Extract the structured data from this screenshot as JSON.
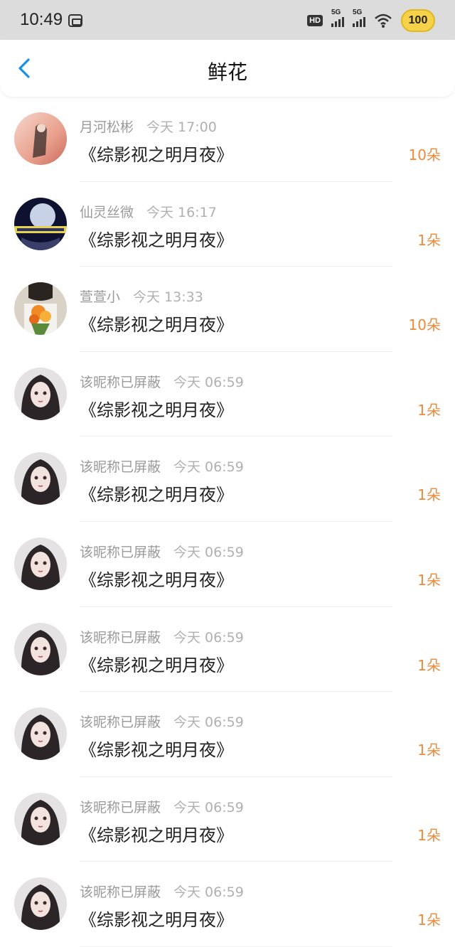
{
  "status": {
    "time": "10:49",
    "hd_label": "HD",
    "network_1": "5G",
    "network_2": "5G",
    "battery": "100"
  },
  "header": {
    "title": "鲜花"
  },
  "rows": [
    {
      "name": "月河松彬",
      "time": "今天 17:00",
      "title": "《综影视之明月夜》",
      "count": "10朵"
    },
    {
      "name": "仙灵丝微",
      "time": "今天 16:17",
      "title": "《综影视之明月夜》",
      "count": "1朵"
    },
    {
      "name": "萱萱小",
      "time": "今天 13:33",
      "title": "《综影视之明月夜》",
      "count": "10朵"
    },
    {
      "name": "该昵称已屏蔽",
      "time": "今天 06:59",
      "title": "《综影视之明月夜》",
      "count": "1朵"
    },
    {
      "name": "该昵称已屏蔽",
      "time": "今天 06:59",
      "title": "《综影视之明月夜》",
      "count": "1朵"
    },
    {
      "name": "该昵称已屏蔽",
      "time": "今天 06:59",
      "title": "《综影视之明月夜》",
      "count": "1朵"
    },
    {
      "name": "该昵称已屏蔽",
      "time": "今天 06:59",
      "title": "《综影视之明月夜》",
      "count": "1朵"
    },
    {
      "name": "该昵称已屏蔽",
      "time": "今天 06:59",
      "title": "《综影视之明月夜》",
      "count": "1朵"
    },
    {
      "name": "该昵称已屏蔽",
      "time": "今天 06:59",
      "title": "《综影视之明月夜》",
      "count": "1朵"
    },
    {
      "name": "该昵称已屏蔽",
      "time": "今天 06:59",
      "title": "《综影视之明月夜》",
      "count": "1朵"
    }
  ],
  "colors": {
    "accent": "#1a8ff0",
    "count": "#ef8a3a"
  }
}
